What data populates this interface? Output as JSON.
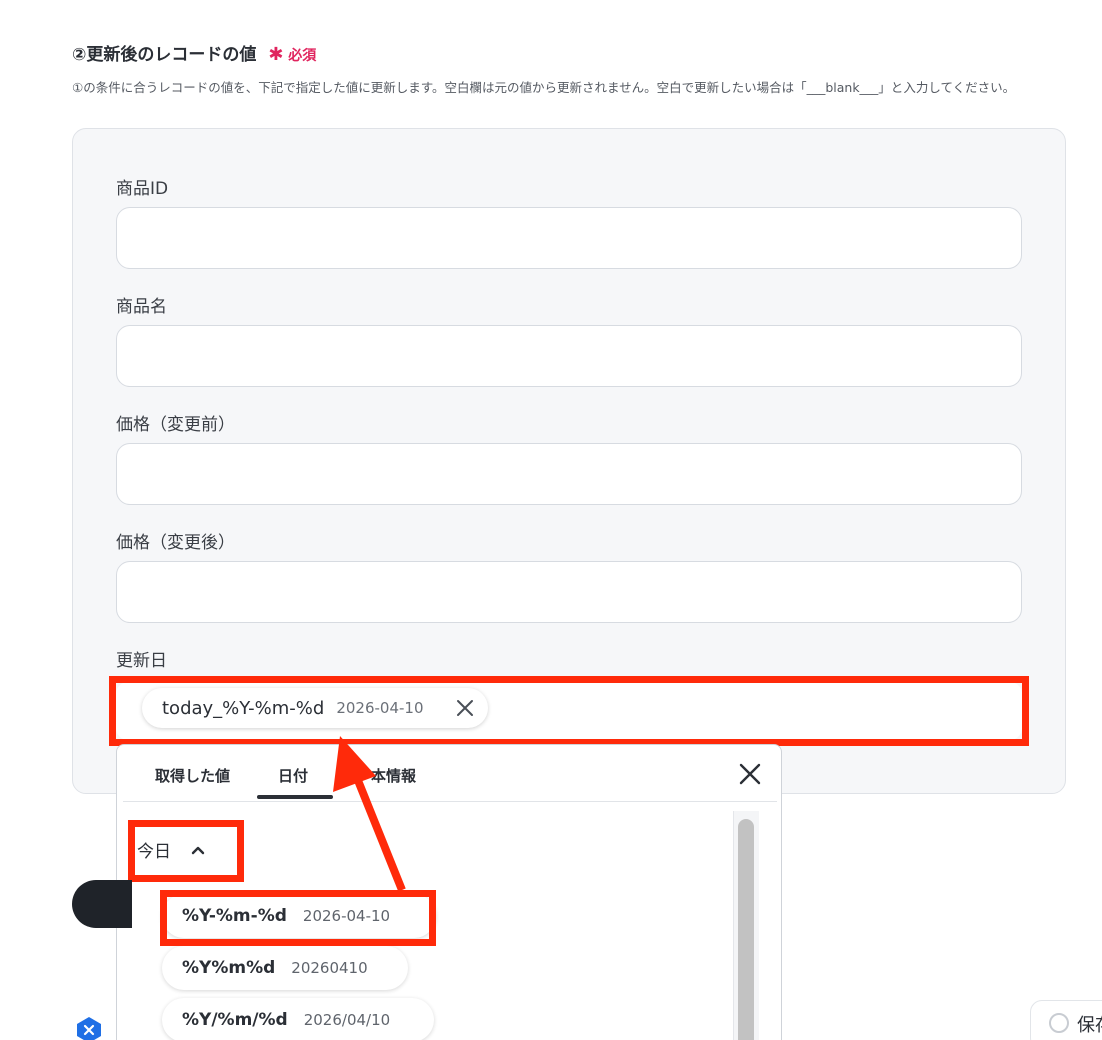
{
  "section": {
    "title": "②更新後のレコードの値",
    "required_star": "✱",
    "required_label": "必須",
    "description": "①の条件に合うレコードの値を、下記で指定した値に更新します。空白欄は元の値から更新されません。空白で更新したい場合は「___blank___」と入力してください。"
  },
  "fields": [
    {
      "label": "商品ID",
      "value": ""
    },
    {
      "label": "商品名",
      "value": ""
    },
    {
      "label": "価格（変更前）",
      "value": ""
    },
    {
      "label": "価格（変更後）",
      "value": ""
    },
    {
      "label": "更新日"
    }
  ],
  "date_chip": {
    "key": "today_%Y-%m-%d",
    "value": "2026-04-10"
  },
  "dropdown": {
    "tabs": [
      "取得した値",
      "日付",
      "本情報"
    ],
    "active_tab": "日付",
    "group_label": "今日",
    "options": [
      {
        "format": "%Y-%m-%d",
        "example": "2026-04-10"
      },
      {
        "format": "%Y%m%d",
        "example": "20260410"
      },
      {
        "format": "%Y/%m/%d",
        "example": "2026/04/10"
      }
    ]
  },
  "footer": {
    "save_label": "保存"
  },
  "colors": {
    "highlight": "#ff2a0a",
    "required": "#e0245e",
    "panel_bg": "#f6f7f9"
  }
}
